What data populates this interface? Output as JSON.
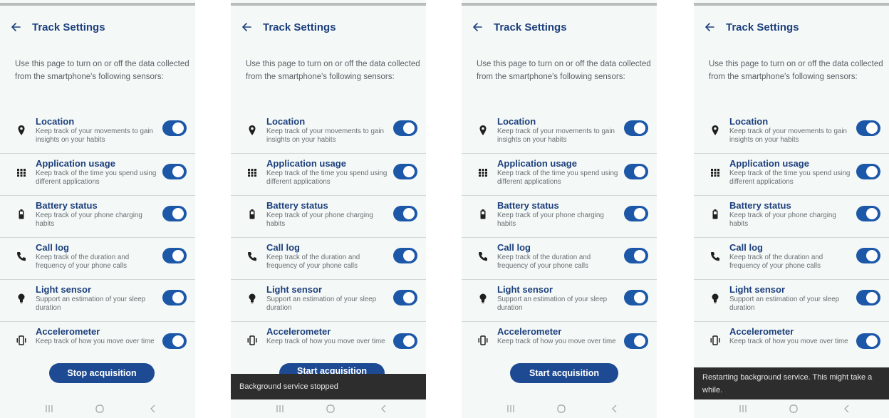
{
  "screens": [
    {
      "title": "Track Settings",
      "button_label": "Stop acquisition",
      "snackbar": ""
    },
    {
      "title": "Track Settings",
      "button_label": "Start acquisition",
      "snackbar": "Background service stopped"
    },
    {
      "title": "Track Settings",
      "button_label": "Start acquisition",
      "snackbar": ""
    },
    {
      "title": "Track Settings",
      "button_label": "",
      "snackbar": "Restarting background service. This might take a while."
    }
  ],
  "intro": "Use this page to turn on or off the data collected from the smartphone's following sensors:",
  "sensors": [
    {
      "icon": "location-pin-icon",
      "label": "Location",
      "desc": "Keep track of your movements to gain insights on your habits",
      "enabled": true
    },
    {
      "icon": "app-grid-icon",
      "label": "Application usage",
      "desc": "Keep track of the time you spend using different applications",
      "enabled": true
    },
    {
      "icon": "battery-icon",
      "label": "Battery status",
      "desc": "Keep track of your phone charging habits",
      "enabled": true
    },
    {
      "icon": "phone-icon",
      "label": "Call log",
      "desc": "Keep track of the duration and frequency of your phone calls",
      "enabled": true
    },
    {
      "icon": "lightbulb-icon",
      "label": "Light sensor",
      "desc": "Support an estimation of your sleep duration",
      "enabled": true
    },
    {
      "icon": "vibration-icon",
      "label": "Accelerometer",
      "desc": "Keep track of how you move over time",
      "enabled": true
    }
  ],
  "nav": {
    "recent": "recent-apps-icon",
    "home": "home-icon",
    "back": "back-icon"
  },
  "colors": {
    "accent": "#1d58a8",
    "title": "#1d3f7c",
    "background": "#f4f9f8",
    "snackbar": "#2d2d2d"
  }
}
